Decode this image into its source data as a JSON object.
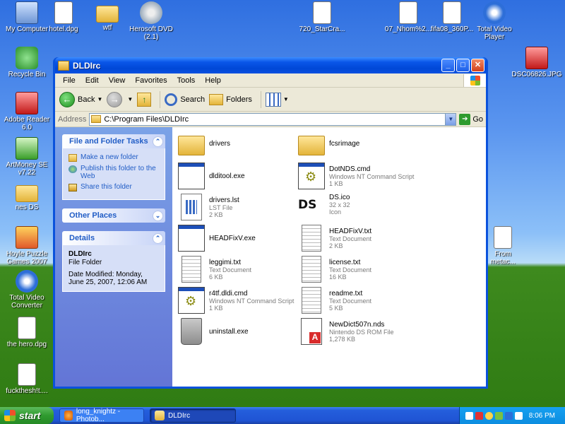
{
  "desktop": {
    "icons": [
      {
        "label": "My Computer",
        "icon": "computer-icon"
      },
      {
        "label": "hotel.dpg",
        "icon": "file-icon"
      },
      {
        "label": "wtf",
        "icon": "folder-icon"
      },
      {
        "label": "Herosoft DVD (2.1)",
        "icon": "dvd-icon"
      },
      {
        "label": "720_StarCra...",
        "icon": "file-icon"
      },
      {
        "label": "07_Nhom%2...",
        "icon": "file-icon"
      },
      {
        "label": "fifa08_360P...",
        "icon": "file-icon"
      },
      {
        "label": "Total Video Player",
        "icon": "media-player-icon"
      },
      {
        "label": "Recycle Bin",
        "icon": "recycle-bin-icon"
      },
      {
        "label": "DSC06826.JPG",
        "icon": "image-file-icon"
      },
      {
        "label": "Adobe Reader 6.0",
        "icon": "adobe-reader-icon"
      },
      {
        "label": "ArtMoney SE v7.22",
        "icon": "artmoney-icon"
      },
      {
        "label": "nes DS",
        "icon": "folder-icon"
      },
      {
        "label": "Hoyle Puzzle Games 2007",
        "icon": "game-icon"
      },
      {
        "label": "Total Video Converter",
        "icon": "converter-icon"
      },
      {
        "label": "the hero.dpg",
        "icon": "file-icon"
      },
      {
        "label": "fuckthesh!t....",
        "icon": "file-icon"
      },
      {
        "label": "From metac...",
        "icon": "file-icon"
      }
    ]
  },
  "window": {
    "title": "DLDIrc",
    "menu": [
      "File",
      "Edit",
      "View",
      "Favorites",
      "Tools",
      "Help"
    ],
    "toolbar": {
      "back": "Back",
      "search": "Search",
      "folders": "Folders"
    },
    "address": {
      "label": "Address",
      "value": "C:\\Program Files\\DLDIrc",
      "go": "Go"
    },
    "tasks_panel": {
      "title": "File and Folder Tasks",
      "items": [
        "Make a new folder",
        "Publish this folder to the Web",
        "Share this folder"
      ]
    },
    "places_panel": {
      "title": "Other Places"
    },
    "details_panel": {
      "title": "Details",
      "name": "DLDIrc",
      "type": "File Folder",
      "modified": "Date Modified: Monday, June 25, 2007, 12:06 AM"
    },
    "files": [
      {
        "name": "drivers",
        "type": "",
        "size": "",
        "icon": "folder-icon"
      },
      {
        "name": "fcsrimage",
        "type": "",
        "size": "",
        "icon": "folder-icon"
      },
      {
        "name": "dlditool.exe",
        "type": "",
        "size": "",
        "icon": "exe-icon"
      },
      {
        "name": "DotNDS.cmd",
        "type": "Windows NT Command Script",
        "size": "1 KB",
        "icon": "cmd-script-icon"
      },
      {
        "name": "drivers.lst",
        "type": "LST File",
        "size": "2 KB",
        "icon": "lst-file-icon"
      },
      {
        "name": "DS.ico",
        "type": "32 x 32",
        "size": "Icon",
        "icon": "ds-logo-icon"
      },
      {
        "name": "HEADFixV.exe",
        "type": "",
        "size": "",
        "icon": "exe-icon"
      },
      {
        "name": "HEADFixV.txt",
        "type": "Text Document",
        "size": "2 KB",
        "icon": "text-document-icon"
      },
      {
        "name": "leggimi.txt",
        "type": "Text Document",
        "size": "6 KB",
        "icon": "text-document-icon"
      },
      {
        "name": "license.txt",
        "type": "Text Document",
        "size": "16 KB",
        "icon": "text-document-icon"
      },
      {
        "name": "r4tf.dldi.cmd",
        "type": "Windows NT Command Script",
        "size": "1 KB",
        "icon": "cmd-script-icon"
      },
      {
        "name": "readme.txt",
        "type": "Text Document",
        "size": "5 KB",
        "icon": "text-document-icon"
      },
      {
        "name": "uninstall.exe",
        "type": "",
        "size": "",
        "icon": "uninstall-icon"
      },
      {
        "name": "NewDict507n.nds",
        "type": "Nintendo DS ROM File",
        "size": "1,278 KB",
        "icon": "nds-rom-icon"
      }
    ]
  },
  "taskbar": {
    "start": "start",
    "tasks": [
      {
        "label": "long_knightz - Photob...",
        "active": false
      },
      {
        "label": "DLDIrc",
        "active": true
      }
    ],
    "clock": "8:06 PM"
  },
  "colors": {
    "xp_blue": "#0a52dc",
    "task_pane": "#6d8ddc",
    "link_blue": "#215dc6",
    "start_green": "#2f9a2f"
  }
}
